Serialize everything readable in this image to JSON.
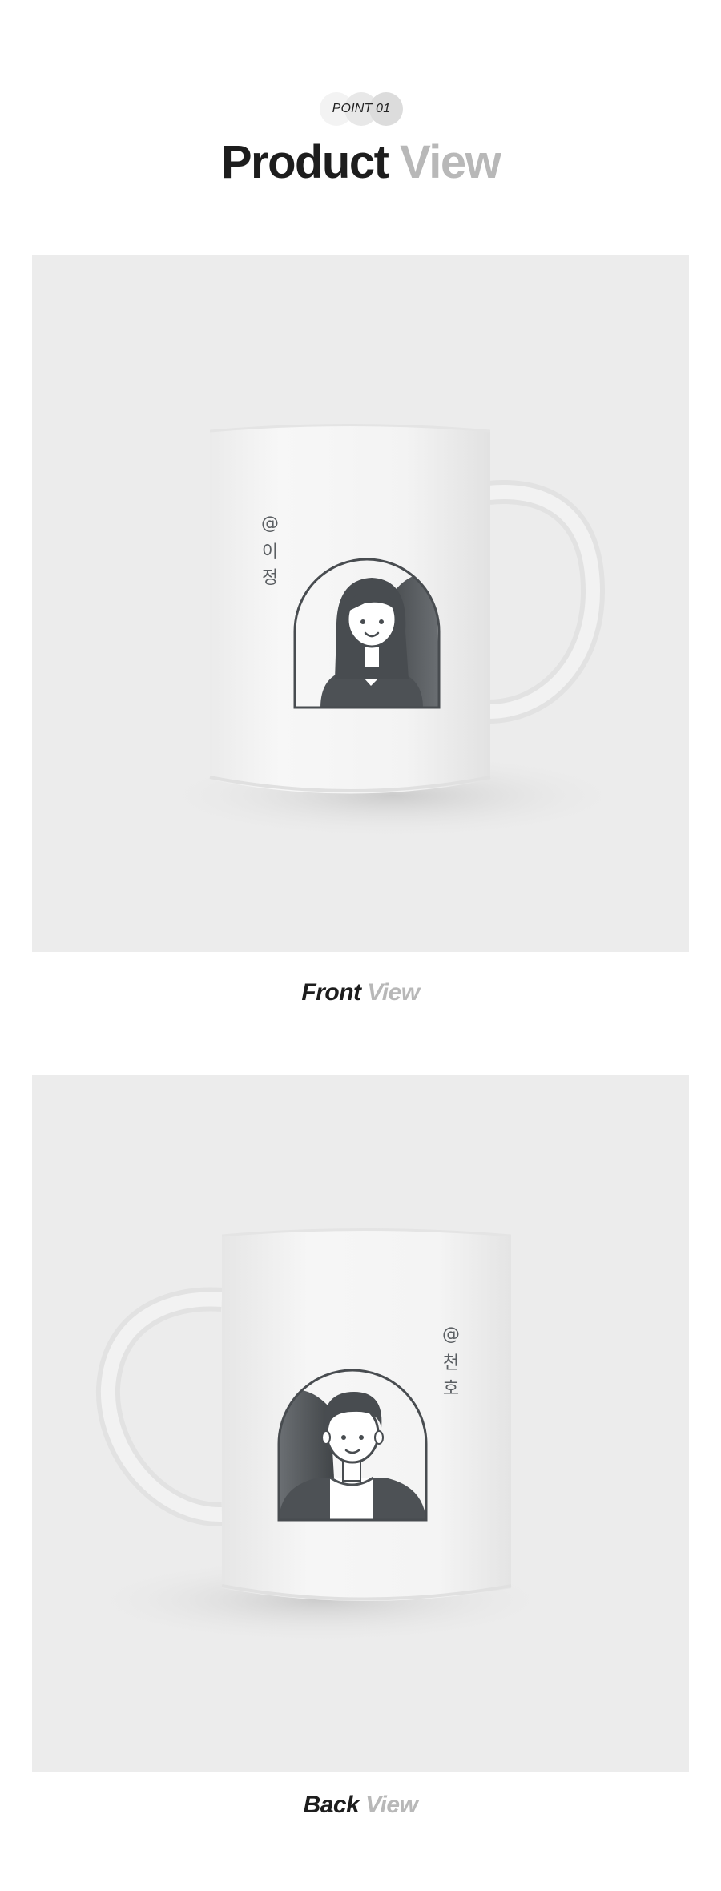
{
  "header": {
    "badge_text": "POINT 01",
    "title_dark": "Product",
    "title_light": "View"
  },
  "front": {
    "handle_text_at": "@",
    "handle_name_chars": [
      "이",
      "정"
    ],
    "caption_dark": "Front",
    "caption_light": "View"
  },
  "back": {
    "handle_text_at": "@",
    "handle_name_chars": [
      "천",
      "호"
    ],
    "caption_dark": "Back",
    "caption_light": "View"
  },
  "colors": {
    "panel_bg": "#ececec",
    "mug_white": "#f4f4f4",
    "print_gray": "#505458",
    "accent_light": "#b8b8b8"
  }
}
